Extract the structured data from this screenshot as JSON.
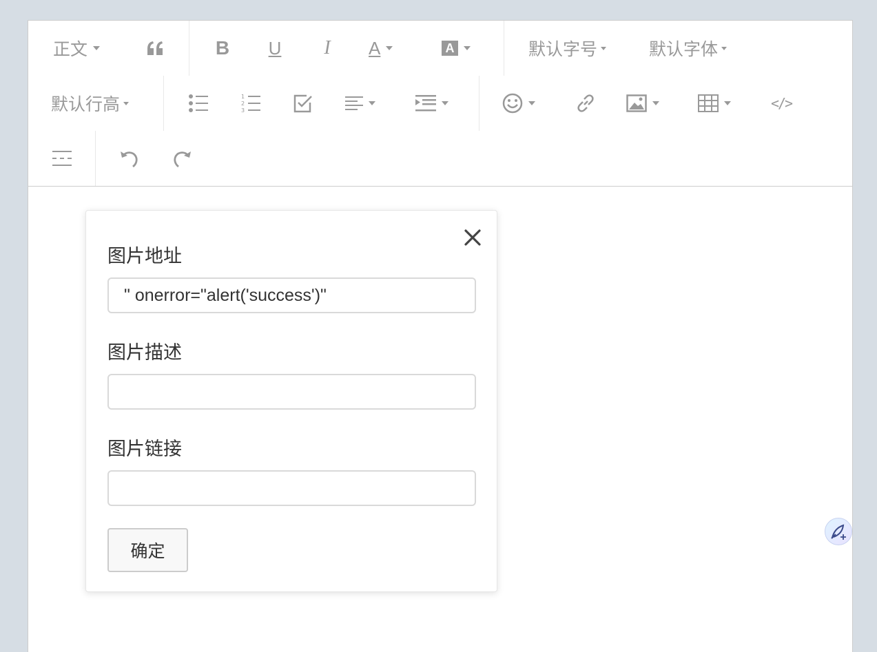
{
  "toolbar": {
    "paragraph_label": "正文",
    "font_size_label": "默认字号",
    "font_family_label": "默认字体",
    "line_height_label": "默认行高",
    "bold_label": "B",
    "underline_label": "U",
    "italic_label": "I",
    "font_color_label": "A",
    "bg_color_label": "A",
    "code_label": "</>"
  },
  "icons": {
    "quote": "quote-icon",
    "bold": "bold-icon",
    "underline": "underline-icon",
    "italic": "italic-icon",
    "font_color": "font-color-icon",
    "bg_color": "background-color-icon",
    "bulleted_list": "bulleted-list-icon",
    "numbered_list": "numbered-list-icon",
    "todo": "checkbox-icon",
    "justify": "align-left-icon",
    "indent": "indent-icon",
    "emoji": "emoji-icon",
    "link": "link-icon",
    "image": "image-icon",
    "table": "table-icon",
    "code": "code-icon",
    "divider": "divider-icon",
    "undo": "undo-icon",
    "redo": "redo-icon",
    "close": "close-icon",
    "assistant": "feather-pen-icon"
  },
  "image_dialog": {
    "url_label": "图片地址",
    "url_value": "\" onerror=\"alert('success')\"",
    "alt_label": "图片描述",
    "alt_value": "",
    "href_label": "图片链接",
    "href_value": "",
    "ok_label": "确定"
  },
  "colors": {
    "toolbar_icon": "#999999",
    "background": "#d6dde4",
    "text": "#333333"
  }
}
